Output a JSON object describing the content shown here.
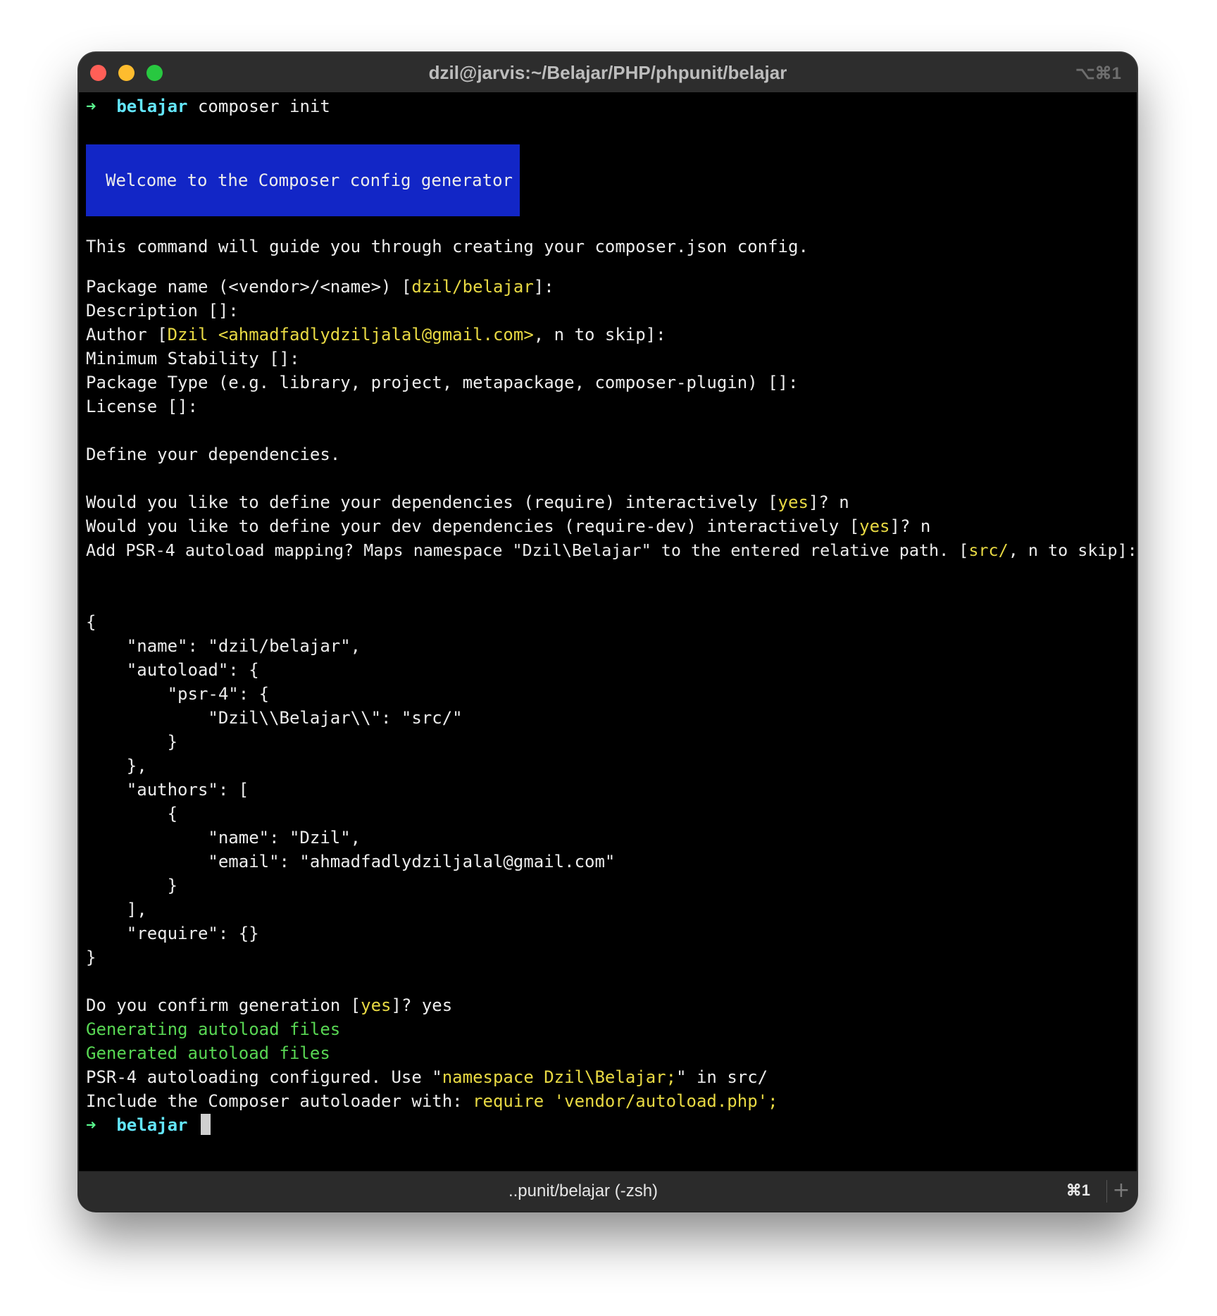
{
  "window": {
    "title": "dzil@jarvis:~/Belajar/PHP/phpunit/belajar",
    "shortcut": "⌥⌘1"
  },
  "terminal": {
    "prompt_arrow": "➜",
    "cwd": "belajar",
    "command": "composer init",
    "banner": "Welcome to the Composer config generator",
    "intro": "This command will guide you through creating your composer.json config.",
    "package_name": {
      "pre": "Package name (<vendor>/<name>) [",
      "def": "dzil/belajar",
      "post": "]:"
    },
    "description": "Description []:",
    "author": {
      "pre": "Author [",
      "def": "Dzil <ahmadfadlydziljalal@gmail.com>",
      "post": ", n to skip]:"
    },
    "min_stability": "Minimum Stability []:",
    "package_type": "Package Type (e.g. library, project, metapackage, composer-plugin) []:",
    "license": "License []:",
    "define_deps": "Define your dependencies.",
    "deps_q": {
      "pre": "Would you like to define your dependencies (require) interactively [",
      "def": "yes",
      "post": "]? n"
    },
    "devdeps_q": {
      "pre": "Would you like to define your dev dependencies (require-dev) interactively [",
      "def": "yes",
      "post": "]? n"
    },
    "psr4_q": {
      "pre": "Add PSR-4 autoload mapping? Maps namespace \"Dzil\\Belajar\" to the entered relative path. [",
      "def": "src/",
      "post": ", n to skip]:"
    },
    "json_lines": [
      "{",
      "    \"name\": \"dzil/belajar\",",
      "    \"autoload\": {",
      "        \"psr-4\": {",
      "            \"Dzil\\\\Belajar\\\\\": \"src/\"",
      "        }",
      "    },",
      "    \"authors\": [",
      "        {",
      "            \"name\": \"Dzil\",",
      "            \"email\": \"ahmadfadlydziljalal@gmail.com\"",
      "        }",
      "    ],",
      "    \"require\": {}",
      "}"
    ],
    "confirm": {
      "pre": "Do you confirm generation [",
      "def": "yes",
      "post": "]? yes"
    },
    "generating": "Generating autoload files",
    "generated": "Generated autoload files",
    "psr4_done": {
      "pre": "PSR-4 autoloading configured. Use \"",
      "hl": "namespace Dzil\\Belajar;",
      "post": "\" in src/"
    },
    "include": {
      "pre": "Include the Composer autoloader with: ",
      "hl": "require 'vendor/autoload.php';"
    },
    "final_cwd": "belajar"
  },
  "tabbar": {
    "tab_title": "..punit/belajar (-zsh)",
    "tab_shortcut": "⌘1",
    "new_tab": "+"
  },
  "colors": {
    "prompt_arrow": "#5af78e",
    "cwd": "#63e6fb",
    "highlight": "#e8d943",
    "success": "#58d653",
    "banner_bg": "#1226c6"
  }
}
